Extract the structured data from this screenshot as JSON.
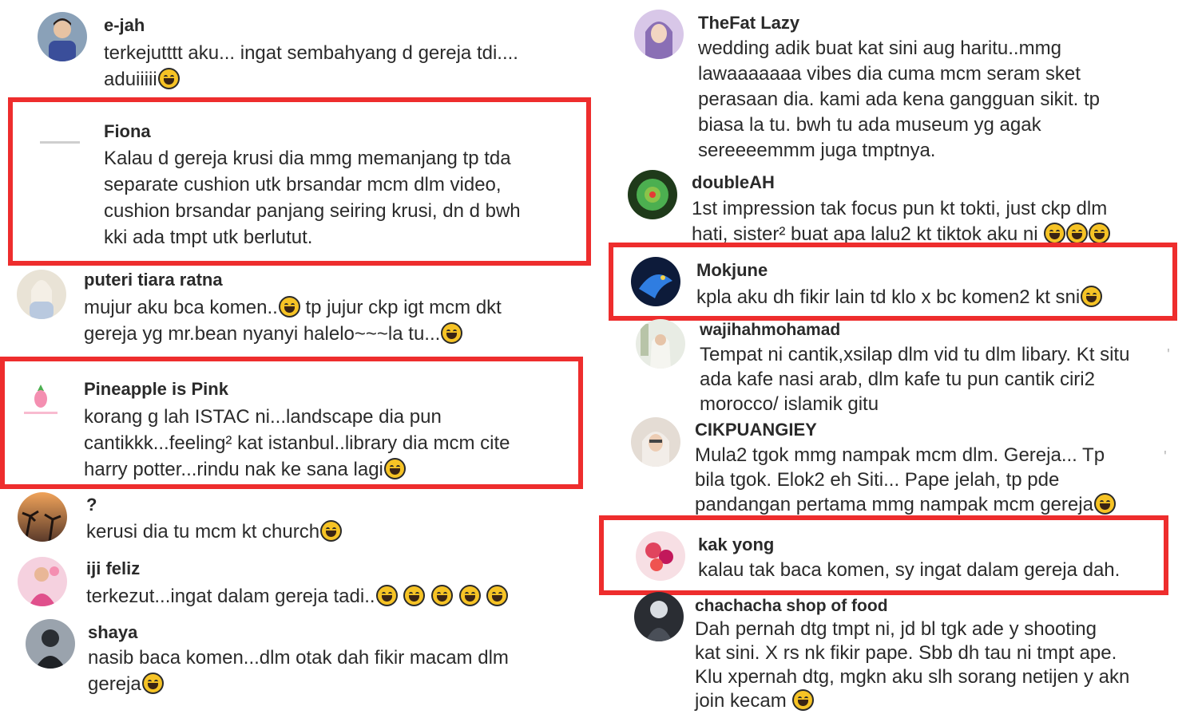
{
  "emoji": {
    "laugh": "😂",
    "rofl": "🤣",
    "sweat_smile": "😅",
    "grin": "😄",
    "sob": "😭",
    "dizzy": "😵",
    "love": "🥰",
    "grin_squint": "😆"
  },
  "left_comments": [
    {
      "user": "e-jah",
      "text": "terkejutttt aku... ingat sembahyang d gereja tdi....\naduiiiii"
    },
    {
      "user": "Fiona",
      "text": "Kalau d gereja krusi dia mmg memanjang tp tda\nseparate cushion utk brsandar mcm dlm video,\ncushion brsandar panjang seiring krusi, dn d bwh\nkki ada tmpt utk berlutut."
    },
    {
      "user": "puteri tiara ratna",
      "text": "mujur aku bca komen..",
      "text2": " tp jujur ckp igt mcm dkt\ngereja yg mr.bean nyanyi halelo~~~la tu..."
    },
    {
      "user": "Pineapple is Pink",
      "text": "korang g lah ISTAC ni...landscape dia pun\ncantikkk...feeling² kat istanbul..library dia mcm cite\nharry potter...rindu nak ke sana lagi"
    },
    {
      "user": "?",
      "text": "kerusi dia tu mcm kt church"
    },
    {
      "user": "iji feliz",
      "text": "terkezut...ingat dalam gereja tadi.."
    },
    {
      "user": "shaya",
      "text": "nasib baca komen...dlm otak dah fikir macam dlm\ngereja"
    }
  ],
  "right_comments": [
    {
      "user": "TheFat Lazy",
      "text": "wedding adik buat kat sini aug haritu..mmg\nlawaaaaaaa vibes dia cuma mcm seram sket\nperasaan dia. kami ada kena gangguan sikit. tp\nbiasa la tu. bwh tu ada museum yg agak\nsereeeemmm juga tmptnya."
    },
    {
      "user": "doubleAH",
      "text": "1st impression tak focus pun kt tokti, just ckp dlm\nhati, sister² buat apa lalu2 kt tiktok aku ni "
    },
    {
      "user": "Mokjune",
      "text": "kpla aku dh fikir lain td klo x bc komen2 kt sni"
    },
    {
      "user": "wajihahmohamad",
      "text": "Tempat ni cantik,xsilap dlm vid tu dlm libary. Kt situ\nada kafe nasi arab, dlm kafe tu pun cantik ciri2\nmorocco/ islamik gitu"
    },
    {
      "user": "CIKPUANGIEY",
      "text": "Mula2 tgok mmg nampak mcm dlm. Gereja... Tp\nbila tgok. Elok2 eh Siti... Pape jelah, tp pde\npandangan pertama mmg nampak mcm gereja"
    },
    {
      "user": "kak yong",
      "text": "kalau tak baca komen, sy ingat dalam gereja dah."
    },
    {
      "user": "chachacha shop of food",
      "text": "Dah pernah dtg tmpt ni, jd bl tgk ade y shooting\nkat sini. X rs nk fikir pape. Sbb dh tau ni tmpt ape.\nKlu xpernah dtg, mgkn aku slh sorang netijen y akn\njoin kecam "
    }
  ],
  "colors": {
    "highlight": "#ee2d2d",
    "text": "#2b2b2b",
    "username": "#2a2a2a",
    "emoji": "#f6c325"
  }
}
